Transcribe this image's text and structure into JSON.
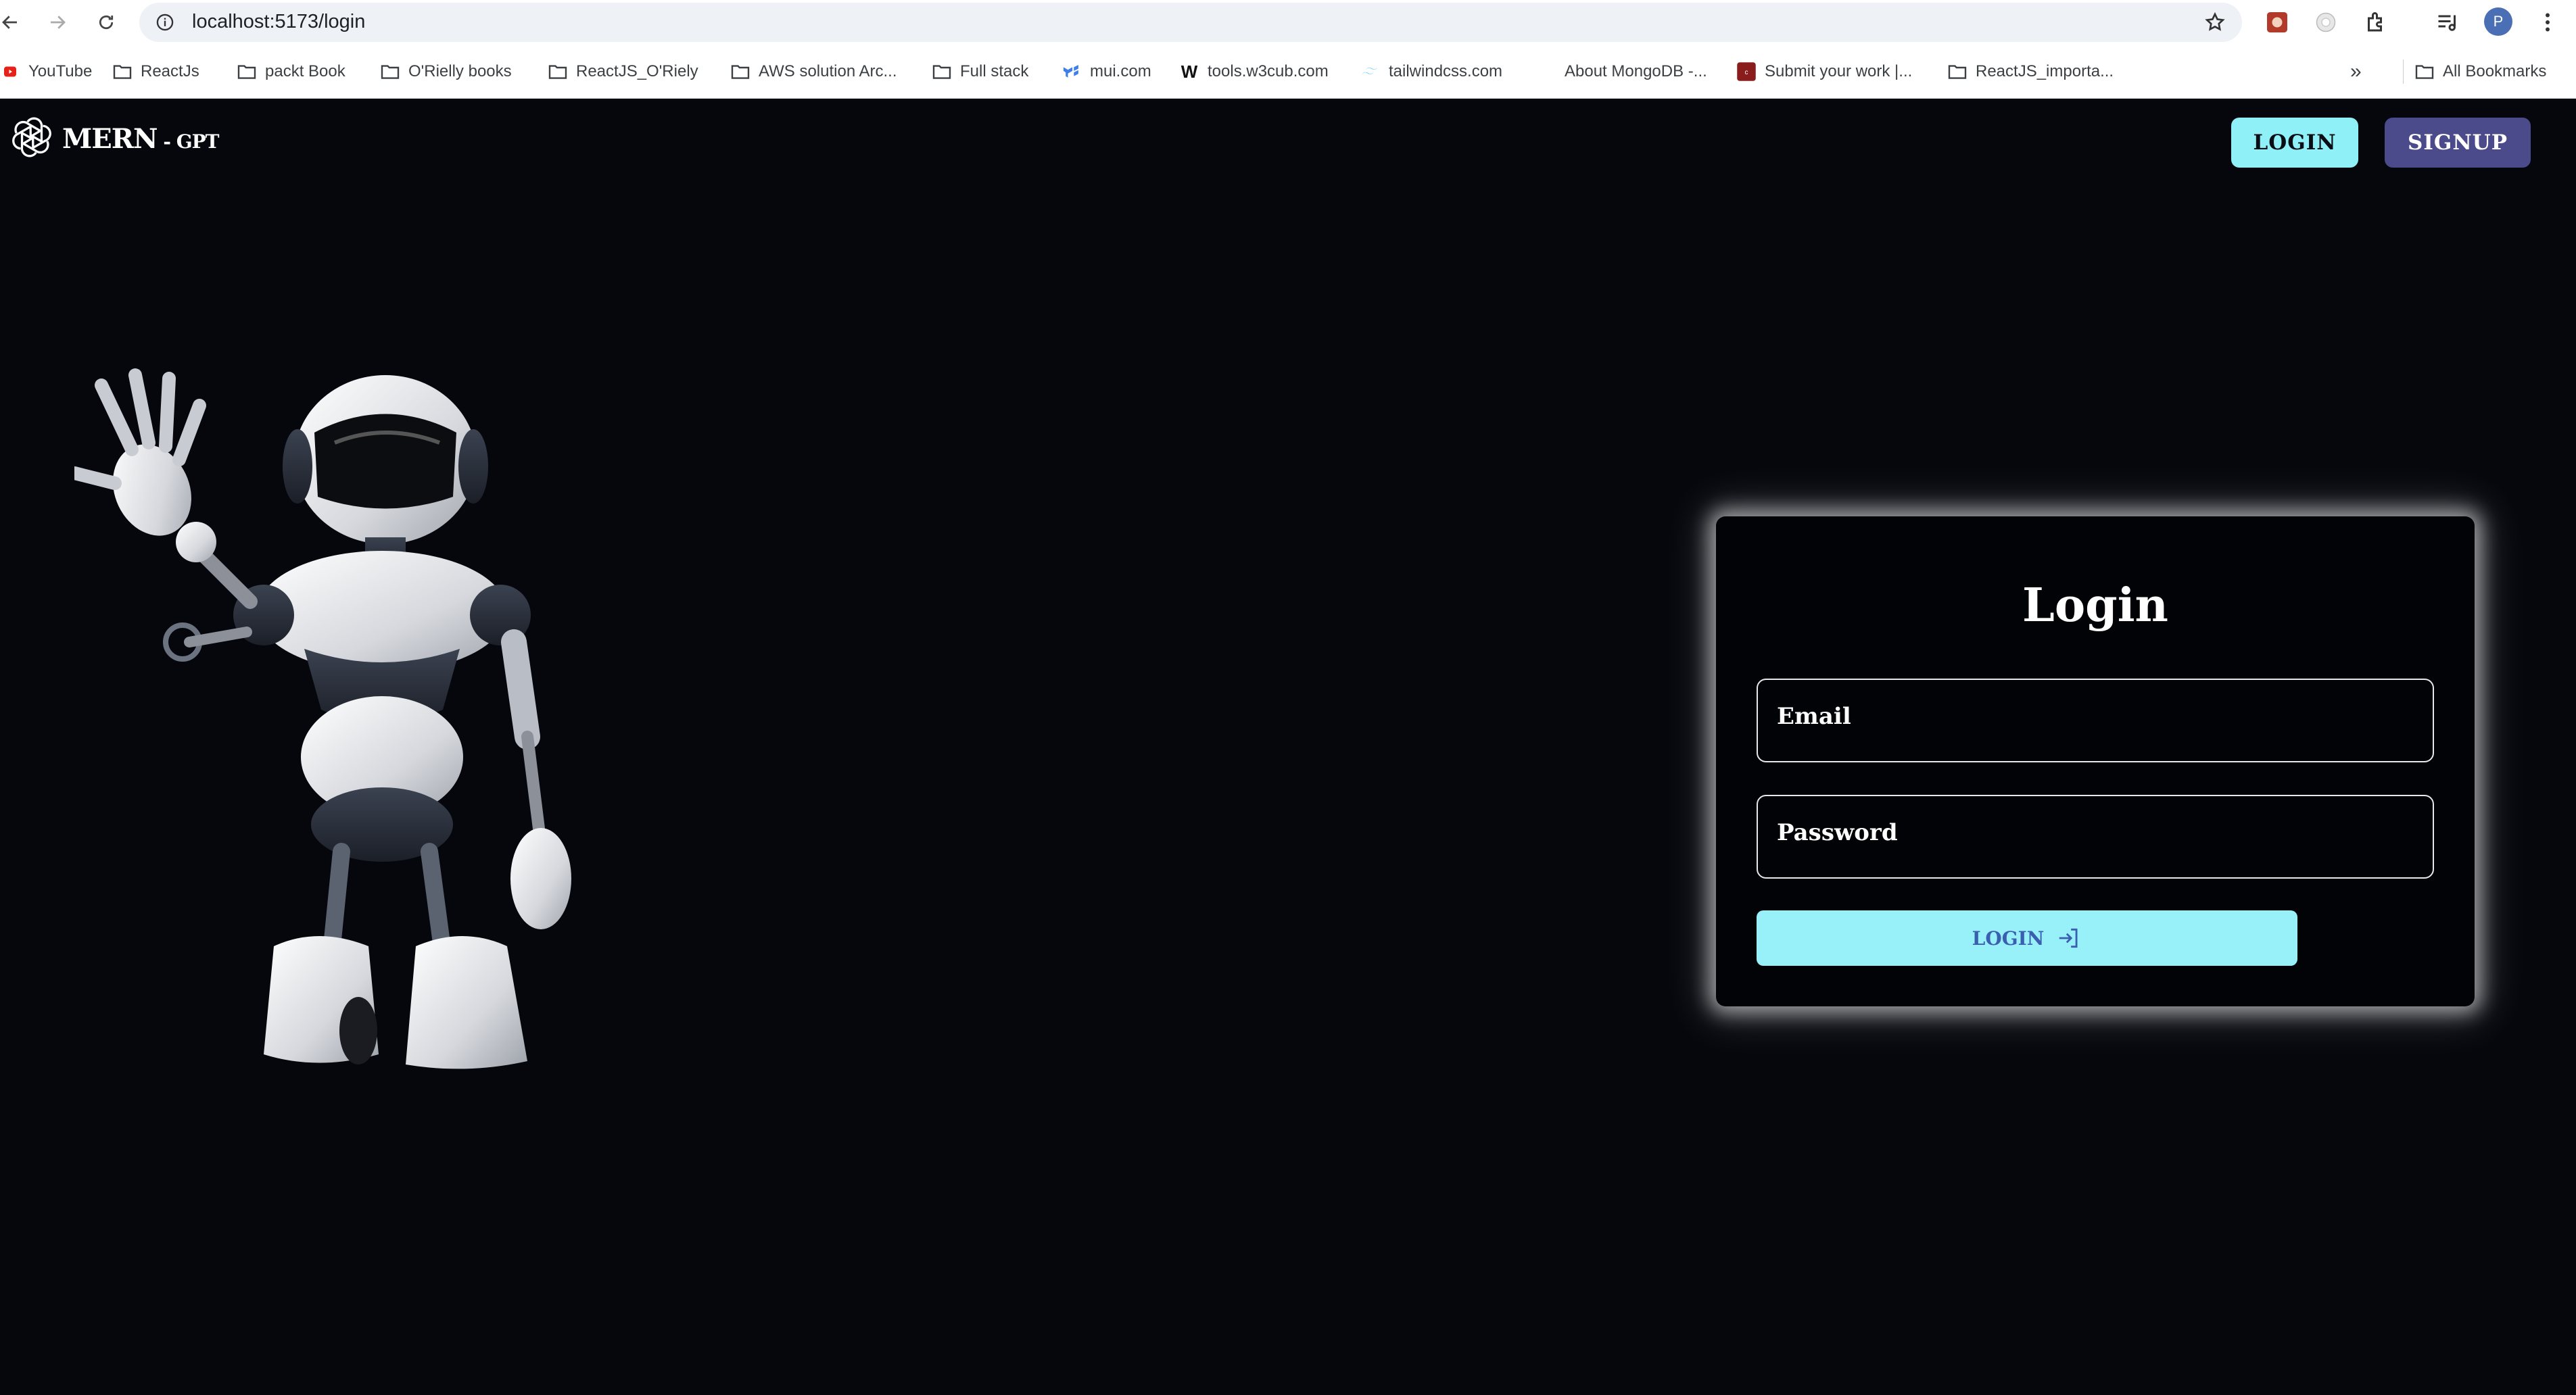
{
  "browser": {
    "url": "localhost:5173/login",
    "profile_initial": "P",
    "bookmarks": [
      {
        "label": "YouTube",
        "icon": "youtube-icon"
      },
      {
        "label": "ReactJs",
        "icon": "folder-icon"
      },
      {
        "label": "packt Book",
        "icon": "folder-icon"
      },
      {
        "label": "O'Rielly books",
        "icon": "folder-icon"
      },
      {
        "label": "ReactJS_O'Riely",
        "icon": "folder-icon"
      },
      {
        "label": "AWS solution Arc...",
        "icon": "folder-icon"
      },
      {
        "label": "Full stack",
        "icon": "folder-icon"
      },
      {
        "label": "mui.com",
        "icon": "mui-icon"
      },
      {
        "label": "tools.w3cub.com",
        "icon": "w3cub-icon"
      },
      {
        "label": "tailwindcss.com",
        "icon": "tailwind-icon"
      },
      {
        "label": "About MongoDB -...",
        "icon": "none"
      },
      {
        "label": "Submit your work |...",
        "icon": "site-icon"
      },
      {
        "label": "ReactJS_importa...",
        "icon": "folder-icon"
      }
    ],
    "overflow_label": "»",
    "all_bookmarks_label": "All Bookmarks"
  },
  "header": {
    "logo_main": "MERN",
    "logo_sub": " - GPT",
    "login_label": "LOGIN",
    "signup_label": "SIGNUP"
  },
  "login_form": {
    "title": "Login",
    "email_label": "Email",
    "password_label": "Password",
    "submit_label": "LOGIN"
  },
  "colors": {
    "background": "#05070d",
    "accent_cyan": "#8ff0f8",
    "signup_purple": "#4b4a8a"
  }
}
